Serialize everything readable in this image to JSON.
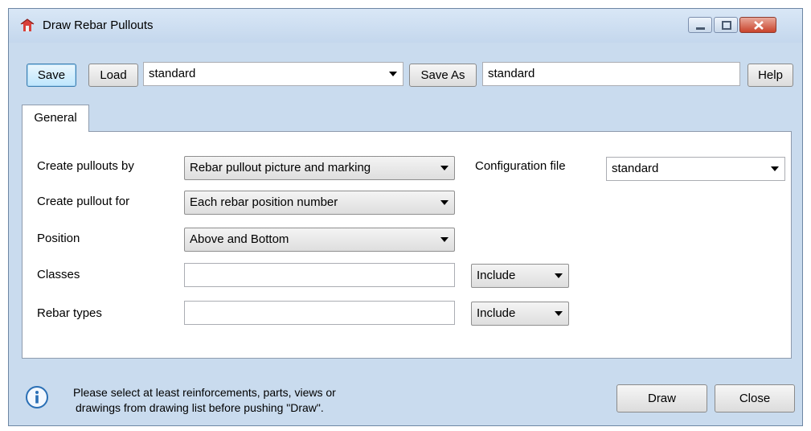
{
  "window": {
    "title": "Draw Rebar Pullouts"
  },
  "toolbar": {
    "save_label": "Save",
    "load_label": "Load",
    "settings_value": "standard",
    "save_as_label": "Save As",
    "save_as_value": "standard",
    "help_label": "Help"
  },
  "tabs": [
    {
      "label": "General"
    }
  ],
  "form": {
    "create_pullouts_by": {
      "label": "Create pullouts by",
      "value": "Rebar pullout picture and marking"
    },
    "configuration_file": {
      "label": "Configuration file",
      "value": "standard"
    },
    "create_pullout_for": {
      "label": "Create pullout for",
      "value": "Each rebar position number"
    },
    "position": {
      "label": "Position",
      "value": "Above and Bottom"
    },
    "classes": {
      "label": "Classes",
      "value": "",
      "mode": "Include"
    },
    "rebar_types": {
      "label": "Rebar types",
      "value": "",
      "mode": "Include"
    }
  },
  "footer": {
    "message_line1": "Please select at least reinforcements, parts, views or",
    "message_line2": "drawings from drawing list before pushing \"Draw\".",
    "draw_label": "Draw",
    "close_label": "Close"
  },
  "icons": {
    "app": "rebar-app-icon",
    "info": "info-icon",
    "minimize": "minimize-icon",
    "maximize": "maximize-icon",
    "close": "close-icon"
  },
  "colors": {
    "window_frame": "#c9dbee",
    "close_button": "#c9432b",
    "info_icon": "#2a6fb5"
  }
}
